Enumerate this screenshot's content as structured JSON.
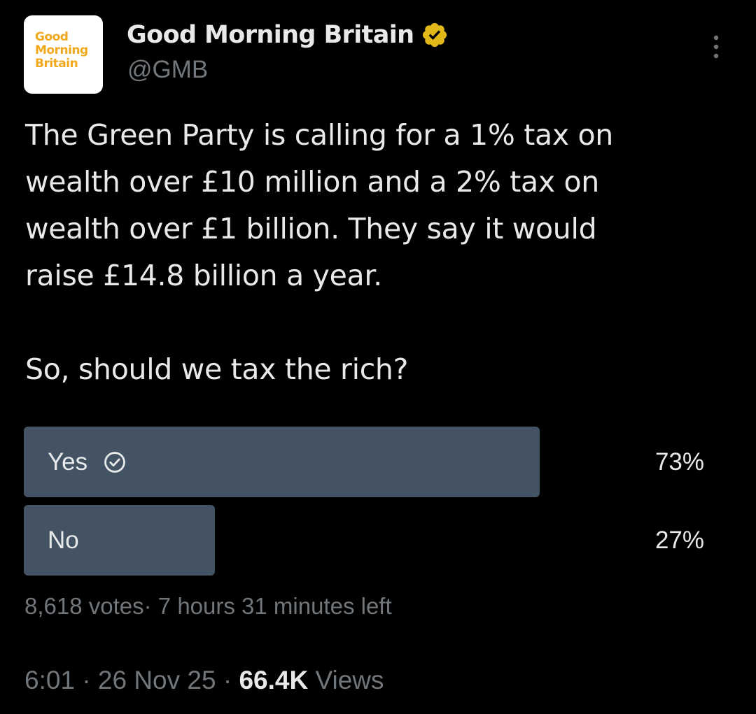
{
  "author": {
    "display_name": "Good Morning Britain",
    "handle": "@GMB",
    "avatar_lines": [
      "Good",
      "Morning",
      "Britain"
    ],
    "verified_badge_color": "#e2b719",
    "avatar_text_color": "#f2a81d"
  },
  "tweet": {
    "text": "The Green Party is calling for a 1% tax on\nwealth over £10 million and a 2% tax on\nwealth over £1 billion. They say it would\nraise £14.8 billion a year.\n\nSo, should we tax the rich?"
  },
  "poll": {
    "options": [
      {
        "label": "Yes",
        "percent": "73%",
        "fraction": 0.73,
        "selected": true
      },
      {
        "label": "No",
        "percent": "27%",
        "fraction": 0.27,
        "selected": false
      }
    ],
    "votes": "8,618 votes",
    "separator": "·",
    "time_left": "7 hours 31 minutes left",
    "bar_color": "#435363"
  },
  "footer": {
    "time": "6:01",
    "date": "26 Nov 25",
    "views_count": "66.4K",
    "views_label": "Views",
    "separator": " · "
  },
  "icons": {
    "verified": "verified-badge-icon",
    "more": "more-options-icon",
    "choice": "check-circle-icon"
  }
}
